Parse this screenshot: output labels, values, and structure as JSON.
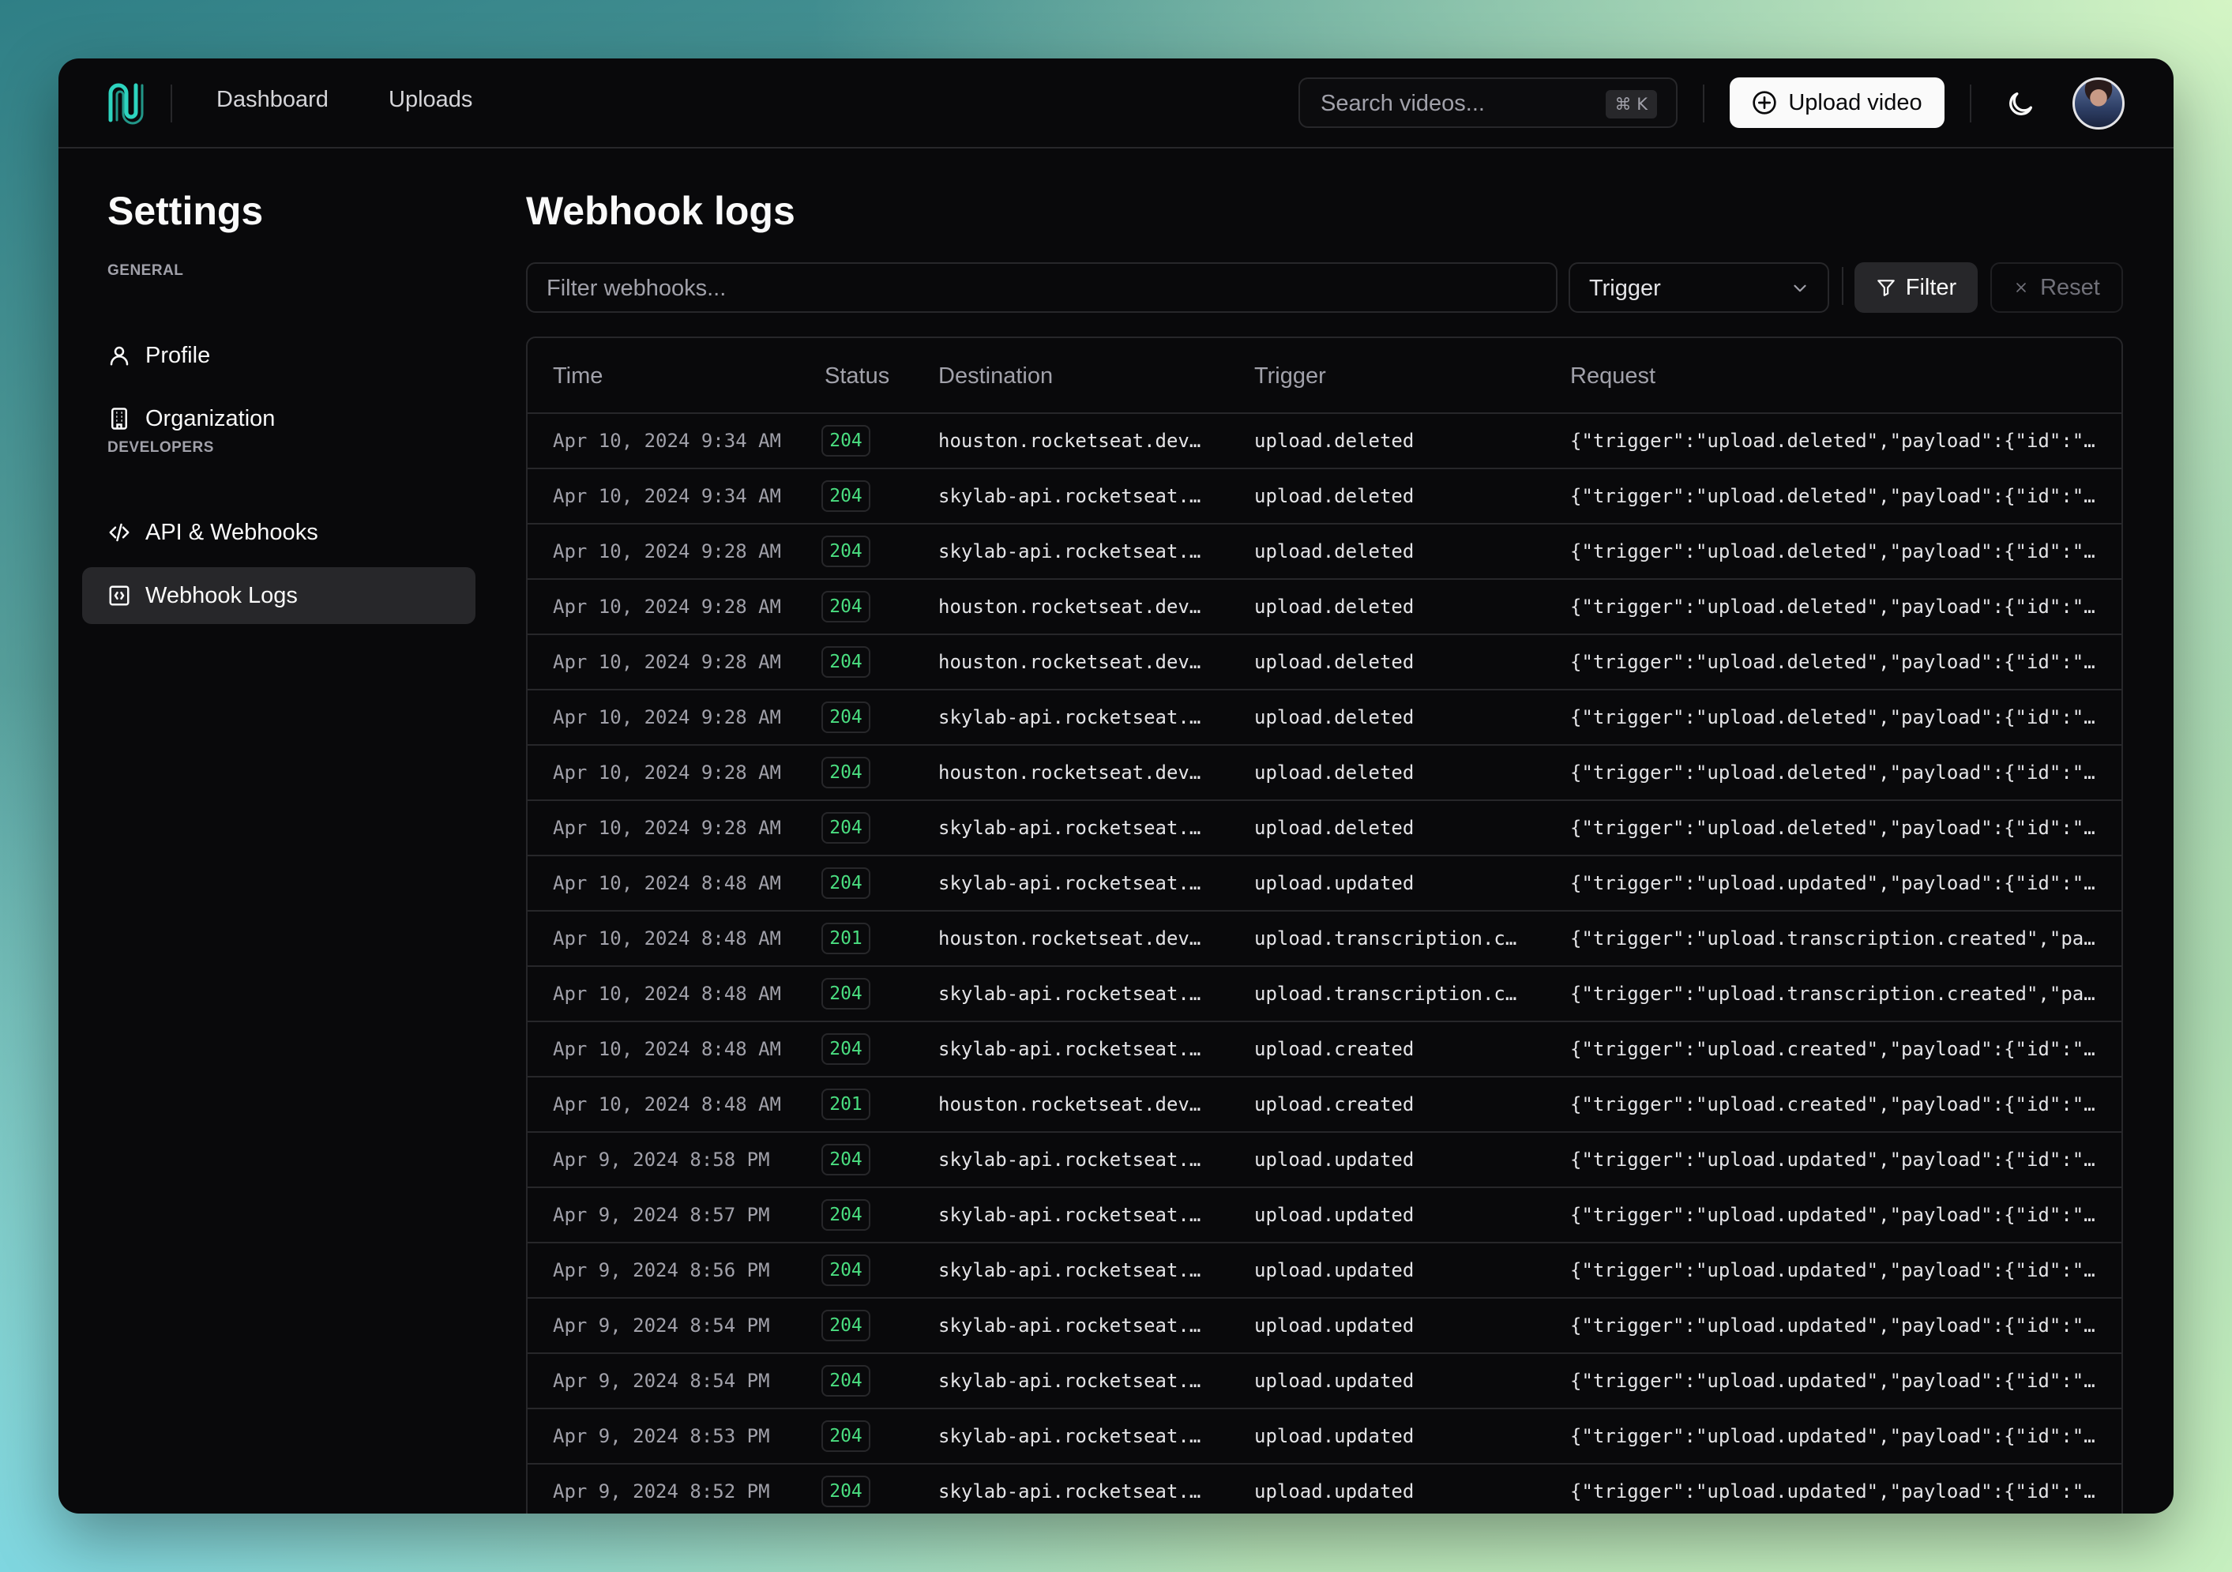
{
  "header": {
    "nav": [
      "Dashboard",
      "Uploads"
    ],
    "search_placeholder": "Search videos...",
    "search_shortcut": "⌘ K",
    "upload_label": "Upload video"
  },
  "sidebar": {
    "title": "Settings",
    "general_label": "GENERAL",
    "developers_label": "DEVELOPERS",
    "items": [
      {
        "label": "Profile",
        "icon": "user-icon"
      },
      {
        "label": "Organization",
        "icon": "building-icon"
      },
      {
        "label": "API & Webhooks",
        "icon": "code-icon"
      },
      {
        "label": "Webhook Logs",
        "icon": "webhook-log-icon",
        "active": true
      }
    ]
  },
  "main": {
    "title": "Webhook logs",
    "filter_placeholder": "Filter webhooks...",
    "trigger_select": "Trigger",
    "filter_label": "Filter",
    "reset_label": "Reset",
    "columns": [
      "Time",
      "Status",
      "Destination",
      "Trigger",
      "Request"
    ],
    "rows": [
      {
        "time": "Apr 10, 2024 9:34 AM",
        "status": "204",
        "destination": "houston.rocketseat.dev…",
        "trigger": "upload.deleted",
        "request": "{\"trigger\":\"upload.deleted\",\"payload\":{\"id\":\"…"
      },
      {
        "time": "Apr 10, 2024 9:34 AM",
        "status": "204",
        "destination": "skylab-api.rocketseat.…",
        "trigger": "upload.deleted",
        "request": "{\"trigger\":\"upload.deleted\",\"payload\":{\"id\":\"…"
      },
      {
        "time": "Apr 10, 2024 9:28 AM",
        "status": "204",
        "destination": "skylab-api.rocketseat.…",
        "trigger": "upload.deleted",
        "request": "{\"trigger\":\"upload.deleted\",\"payload\":{\"id\":\"…"
      },
      {
        "time": "Apr 10, 2024 9:28 AM",
        "status": "204",
        "destination": "houston.rocketseat.dev…",
        "trigger": "upload.deleted",
        "request": "{\"trigger\":\"upload.deleted\",\"payload\":{\"id\":\"…"
      },
      {
        "time": "Apr 10, 2024 9:28 AM",
        "status": "204",
        "destination": "houston.rocketseat.dev…",
        "trigger": "upload.deleted",
        "request": "{\"trigger\":\"upload.deleted\",\"payload\":{\"id\":\"…"
      },
      {
        "time": "Apr 10, 2024 9:28 AM",
        "status": "204",
        "destination": "skylab-api.rocketseat.…",
        "trigger": "upload.deleted",
        "request": "{\"trigger\":\"upload.deleted\",\"payload\":{\"id\":\"…"
      },
      {
        "time": "Apr 10, 2024 9:28 AM",
        "status": "204",
        "destination": "houston.rocketseat.dev…",
        "trigger": "upload.deleted",
        "request": "{\"trigger\":\"upload.deleted\",\"payload\":{\"id\":\"…"
      },
      {
        "time": "Apr 10, 2024 9:28 AM",
        "status": "204",
        "destination": "skylab-api.rocketseat.…",
        "trigger": "upload.deleted",
        "request": "{\"trigger\":\"upload.deleted\",\"payload\":{\"id\":\"…"
      },
      {
        "time": "Apr 10, 2024 8:48 AM",
        "status": "204",
        "destination": "skylab-api.rocketseat.…",
        "trigger": "upload.updated",
        "request": "{\"trigger\":\"upload.updated\",\"payload\":{\"id\":\"…"
      },
      {
        "time": "Apr 10, 2024 8:48 AM",
        "status": "201",
        "destination": "houston.rocketseat.dev…",
        "trigger": "upload.transcription.c…",
        "request": "{\"trigger\":\"upload.transcription.created\",\"pa…"
      },
      {
        "time": "Apr 10, 2024 8:48 AM",
        "status": "204",
        "destination": "skylab-api.rocketseat.…",
        "trigger": "upload.transcription.c…",
        "request": "{\"trigger\":\"upload.transcription.created\",\"pa…"
      },
      {
        "time": "Apr 10, 2024 8:48 AM",
        "status": "204",
        "destination": "skylab-api.rocketseat.…",
        "trigger": "upload.created",
        "request": "{\"trigger\":\"upload.created\",\"payload\":{\"id\":\"…"
      },
      {
        "time": "Apr 10, 2024 8:48 AM",
        "status": "201",
        "destination": "houston.rocketseat.dev…",
        "trigger": "upload.created",
        "request": "{\"trigger\":\"upload.created\",\"payload\":{\"id\":\"…"
      },
      {
        "time": "Apr 9, 2024 8:58 PM",
        "status": "204",
        "destination": "skylab-api.rocketseat.…",
        "trigger": "upload.updated",
        "request": "{\"trigger\":\"upload.updated\",\"payload\":{\"id\":\"…"
      },
      {
        "time": "Apr 9, 2024 8:57 PM",
        "status": "204",
        "destination": "skylab-api.rocketseat.…",
        "trigger": "upload.updated",
        "request": "{\"trigger\":\"upload.updated\",\"payload\":{\"id\":\"…"
      },
      {
        "time": "Apr 9, 2024 8:56 PM",
        "status": "204",
        "destination": "skylab-api.rocketseat.…",
        "trigger": "upload.updated",
        "request": "{\"trigger\":\"upload.updated\",\"payload\":{\"id\":\"…"
      },
      {
        "time": "Apr 9, 2024 8:54 PM",
        "status": "204",
        "destination": "skylab-api.rocketseat.…",
        "trigger": "upload.updated",
        "request": "{\"trigger\":\"upload.updated\",\"payload\":{\"id\":\"…"
      },
      {
        "time": "Apr 9, 2024 8:54 PM",
        "status": "204",
        "destination": "skylab-api.rocketseat.…",
        "trigger": "upload.updated",
        "request": "{\"trigger\":\"upload.updated\",\"payload\":{\"id\":\"…"
      },
      {
        "time": "Apr 9, 2024 8:53 PM",
        "status": "204",
        "destination": "skylab-api.rocketseat.…",
        "trigger": "upload.updated",
        "request": "{\"trigger\":\"upload.updated\",\"payload\":{\"id\":\"…"
      },
      {
        "time": "Apr 9, 2024 8:52 PM",
        "status": "204",
        "destination": "skylab-api.rocketseat.…",
        "trigger": "upload.updated",
        "request": "{\"trigger\":\"upload.updated\",\"payload\":{\"id\":\"…"
      }
    ]
  },
  "colors": {
    "background": "#09090b",
    "border": "#27272a",
    "status_success": "#4ade80",
    "logo_accent": "#2dd4bf"
  }
}
